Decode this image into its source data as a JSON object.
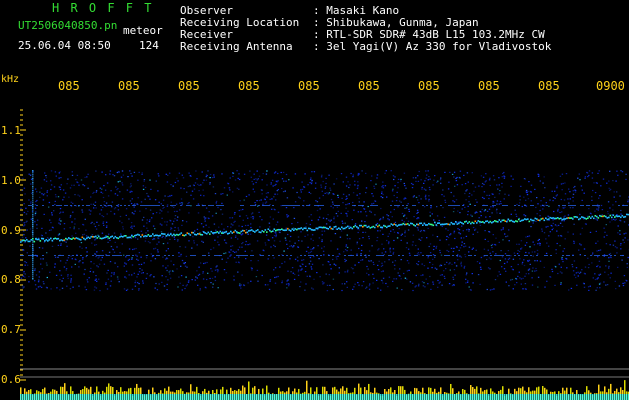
{
  "header": {
    "station": "H R O F F T",
    "filename": "UT2506040850.pn",
    "mode": "meteor",
    "datetime": "25.06.04 08:50",
    "count": "124"
  },
  "info": [
    {
      "label": "Observer",
      "value": ": Masaki Kano"
    },
    {
      "label": "Receiving Location",
      "value": ": Shibukawa, Gunma, Japan"
    },
    {
      "label": "Receiver",
      "value": ": RTL-SDR SDR# 43dB L15 103.2MHz CW"
    },
    {
      "label": "Receiving Antenna",
      "value": ": 3el Yagi(V) Az 330 for Vladivostok"
    }
  ],
  "axis": {
    "unit": "kHz",
    "yticks": [
      "1.1",
      "1.0",
      "0.9",
      "0.8",
      "0.7",
      "0.6"
    ],
    "xticks": [
      "085",
      "085",
      "085",
      "085",
      "085",
      "085",
      "085",
      "085",
      "085",
      "0900"
    ]
  },
  "spectrogram": {
    "y_range_khz": [
      0.6,
      1.15
    ],
    "signal_trace_khz": {
      "start": 0.88,
      "end": 0.93
    },
    "noise_band_khz": [
      0.78,
      1.02
    ],
    "colors": {
      "text_green": "#33dd33",
      "axis_yellow": "#ffd21a",
      "noise_blue": "#1133ff",
      "bar_cyan": "#33ffff"
    }
  }
}
